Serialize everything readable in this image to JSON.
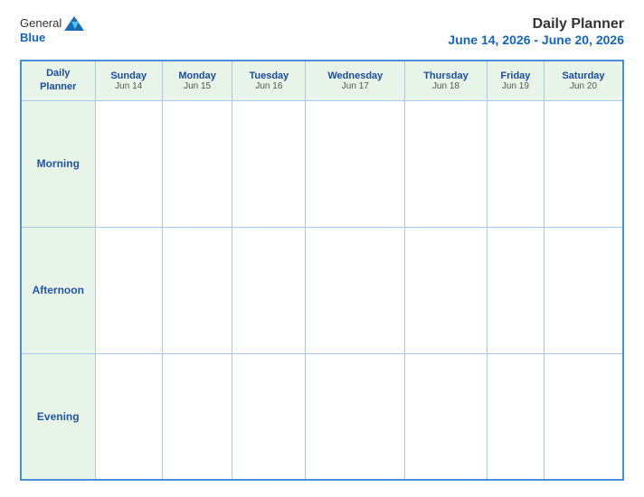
{
  "logo": {
    "general": "General",
    "blue": "Blue",
    "icon_shape": "triangle"
  },
  "header": {
    "title": "Daily Planner",
    "date_range": "June 14, 2026 - June 20, 2026"
  },
  "table": {
    "label_header_line1": "Daily",
    "label_header_line2": "Planner",
    "columns": [
      {
        "day": "Sunday",
        "date": "Jun 14"
      },
      {
        "day": "Monday",
        "date": "Jun 15"
      },
      {
        "day": "Tuesday",
        "date": "Jun 16"
      },
      {
        "day": "Wednesday",
        "date": "Jun 17"
      },
      {
        "day": "Thursday",
        "date": "Jun 18"
      },
      {
        "day": "Friday",
        "date": "Jun 19"
      },
      {
        "day": "Saturday",
        "date": "Jun 20"
      }
    ],
    "rows": [
      {
        "label": "Morning"
      },
      {
        "label": "Afternoon"
      },
      {
        "label": "Evening"
      }
    ]
  }
}
